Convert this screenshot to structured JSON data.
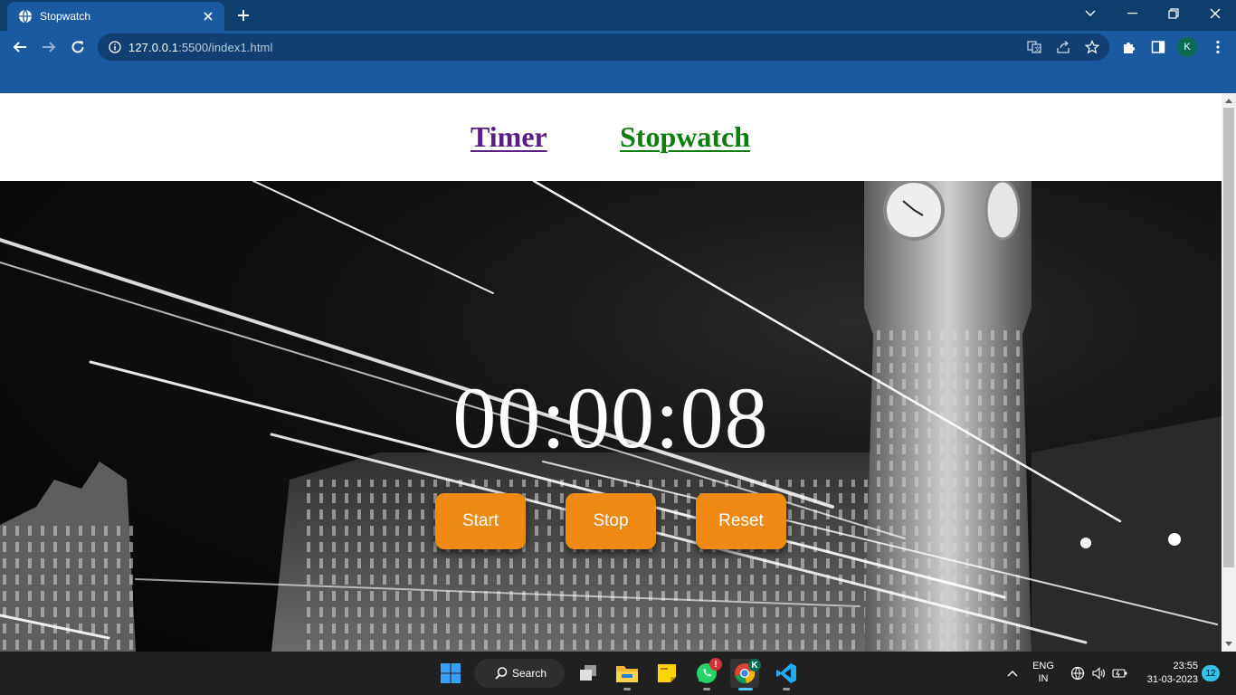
{
  "browser": {
    "tab_title": "Stopwatch",
    "url_host": "127.0.0.1",
    "url_path": ":5500/index1.html",
    "profile_initial": "K"
  },
  "page": {
    "nav": {
      "timer_label": "Timer",
      "stopwatch_label": "Stopwatch"
    },
    "stopwatch": {
      "time_display": "00:00:08",
      "start_label": "Start",
      "stop_label": "Stop",
      "reset_label": "Reset"
    },
    "colors": {
      "timer_link": "#5a1e86",
      "stopwatch_link": "#107d10",
      "button_bg": "#ee8914",
      "browser_frame": "#1a5aa0"
    }
  },
  "taskbar": {
    "search_label": "Search",
    "whatsapp_badge": "!",
    "chrome_profile_badge": "K",
    "lang_line1": "ENG",
    "lang_line2": "IN",
    "time": "23:55",
    "date": "31-03-2023",
    "notification_count": "12",
    "pinned_apps": [
      "windows-start-icon",
      "task-view-icon",
      "file-explorer-icon",
      "sticky-notes-icon",
      "whatsapp-icon",
      "chrome-icon",
      "vscode-icon"
    ]
  }
}
